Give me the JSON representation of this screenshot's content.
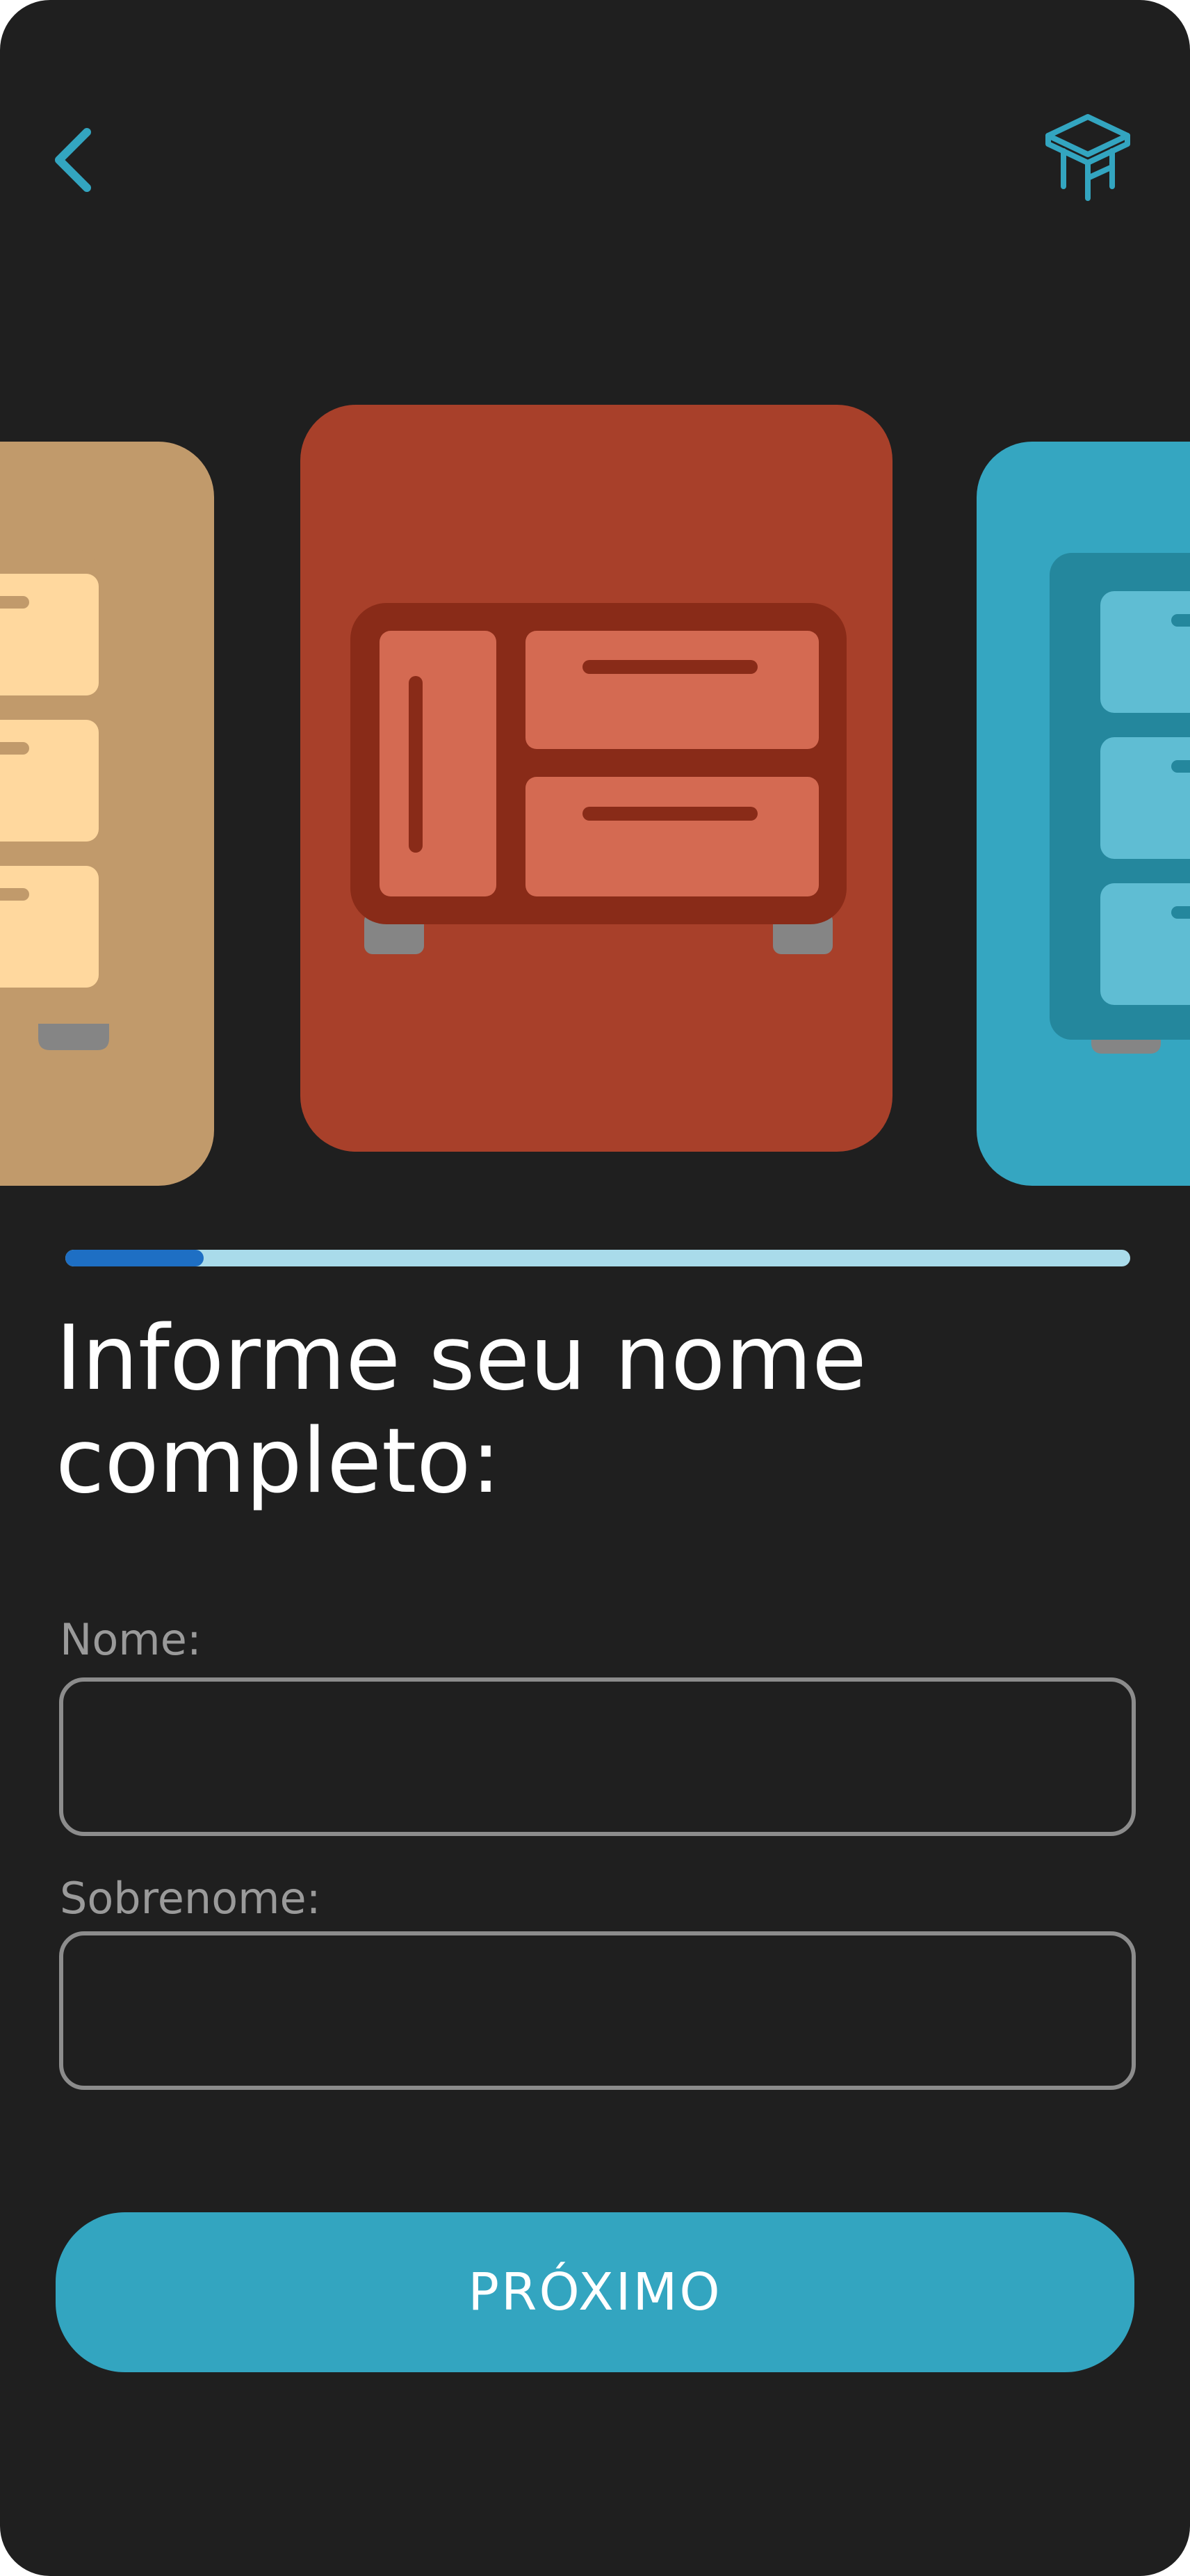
{
  "header": {
    "back_icon": "chevron-left-icon",
    "logo_icon": "furniture-table-icon",
    "accent_color": "#33a5c0"
  },
  "carousel": {
    "cards": [
      {
        "name": "wardrobe",
        "color": "#c19a6b",
        "position": "left-partial"
      },
      {
        "name": "sideboard",
        "color": "#a8402a",
        "position": "center-selected"
      },
      {
        "name": "cabinet",
        "color": "#35a6c1",
        "position": "right-partial"
      }
    ]
  },
  "progress": {
    "value": 0.13,
    "fill_color": "#1e6fc4",
    "track_color": "#a9dbea"
  },
  "form": {
    "title": "Informe seu nome completo:",
    "first_name": {
      "label": "Nome:",
      "value": "",
      "placeholder": ""
    },
    "last_name": {
      "label": "Sobrenome:",
      "value": "",
      "placeholder": ""
    }
  },
  "next_button": {
    "label": "PRÓXIMO"
  }
}
